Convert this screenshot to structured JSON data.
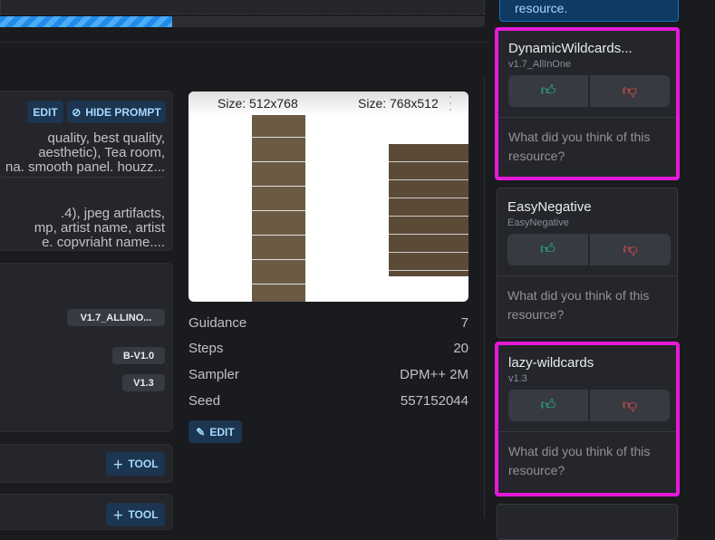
{
  "progress": {
    "percent": 35.5
  },
  "prompt_panel": {
    "edit_label": "EDIT",
    "hide_prompt_label": "HIDE PROMPT",
    "positive_lines": [
      "quality, best quality,",
      "aesthetic), Tea room,",
      "na. smooth panel. houzz..."
    ],
    "negative_lines": [
      ".4), jpeg artifacts,",
      "mp, artist name, artist",
      "e. copvriaht name...."
    ]
  },
  "resources_panel": {
    "badges": [
      "V1.7_ALLINO...",
      "B-V1.0",
      "V1.3"
    ]
  },
  "tool_buttons": [
    "TOOL",
    "TOOL"
  ],
  "image": {
    "left_label": "Size: 512x768",
    "right_label": "Size: 768x512"
  },
  "meta": [
    {
      "label": "Guidance",
      "value": "7"
    },
    {
      "label": "Steps",
      "value": "20"
    },
    {
      "label": "Sampler",
      "value": "DPM++ 2M"
    },
    {
      "label": "Seed",
      "value": "557152044"
    }
  ],
  "meta_edit_label": "EDIT",
  "top_notice": "resource.",
  "cards": [
    {
      "title": "DynamicWildcards...",
      "version": "v1.7_AllInOne",
      "question": "What did you think of this resource?"
    },
    {
      "title": "EasyNegative",
      "version": "EasyNegative",
      "question": "What did you think of this resource?"
    },
    {
      "title": "lazy-wildcards",
      "version": "v1.3",
      "question": "What did you think of this resource?"
    }
  ]
}
